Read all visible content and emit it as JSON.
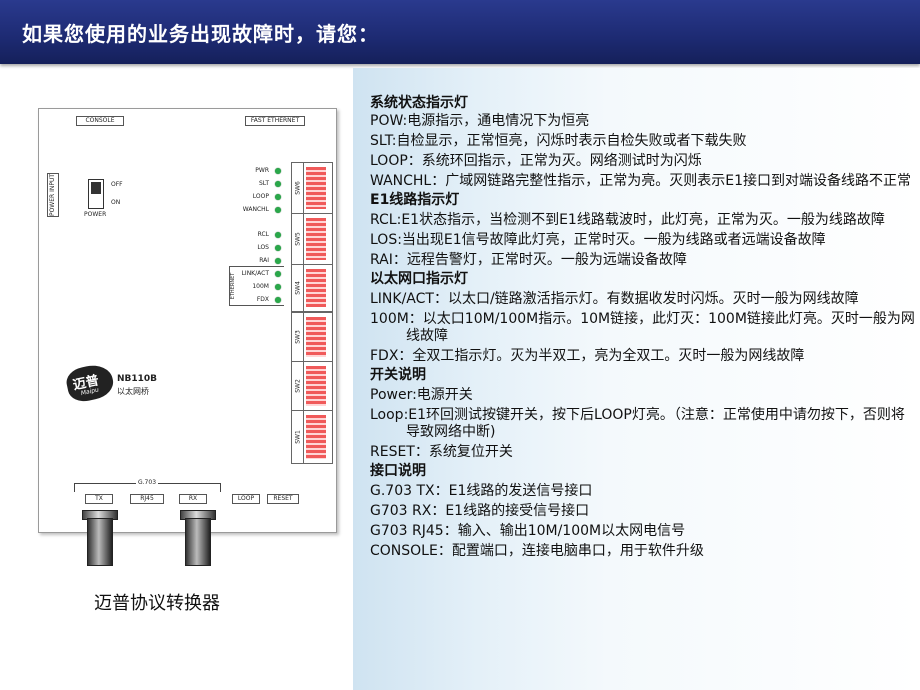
{
  "header": {
    "title": "如果您使用的业务出现故障时，请您："
  },
  "device": {
    "console_label": "CONSOLE",
    "fast_ethernet_label": "FAST ETHERNET",
    "power_input_label": "POWER INPUT",
    "switch_off": "OFF",
    "switch_on": "ON",
    "power_label": "POWER",
    "leds": [
      "PWR",
      "SLT",
      "LOOP",
      "WANCHL",
      "RCL",
      "LOS",
      "RAI",
      "LINK/ACT",
      "100M",
      "FDX"
    ],
    "ethernet_label": "ETHERNET",
    "switches": [
      "SW6",
      "SW5",
      "SW4",
      "SW3",
      "SW2",
      "SW1"
    ],
    "logo_text": "迈普",
    "logo_sub": "Maipu",
    "model": "NB110B",
    "model_sub": "以太网桥",
    "g703_label": "G.703",
    "ports": [
      "TX",
      "RJ45",
      "RX"
    ],
    "loop_button": "LOOP",
    "reset_button": "RESET"
  },
  "caption": "迈普协议转换器",
  "content": {
    "sec1_title": "系统状态指示灯",
    "pow": "POW:电源指示，通电情况下为恒亮",
    "slt": "SLT:自检显示，正常恒亮，闪烁时表示自检失败或者下载失败",
    "loop": "LOOP：系统环回指示，正常为灭。网络测试时为闪烁",
    "wanchl": "WANCHL：广域网链路完整性指示，正常为亮。灭则表示E1接口到对端设备线路不正常",
    "sec2_title": "E1线路指示灯",
    "rcl": "RCL:E1状态指示，当检测不到E1线路载波时，此灯亮，正常为灭。一般为线路故障",
    "los": "LOS:当出现E1信号故障此灯亮，正常时灭。一般为线路或者远端设备故障",
    "rai": "RAI：远程告警灯，正常时灭。一般为远端设备故障",
    "sec3_title": "以太网口指示灯",
    "linkact": "LINK/ACT：以太口/链路激活指示灯。有数据收发时闪烁。灭时一般为网线故障",
    "m100": "100M：以太口10M/100M指示。10M链接，此灯灭：100M链接此灯亮。灭时一般为网线故障",
    "fdx": "FDX：全双工指示灯。灭为半双工，亮为全双工。灭时一般为网线故障",
    "sec4_title": "开关说明",
    "power": "Power:电源开关",
    "loop_sw": "Loop:E1环回测试按键开关，按下后LOOP灯亮。（注意：正常使用中请勿按下，否则将导致网络中断)",
    "reset": "RESET：系统复位开关",
    "sec5_title": "接口说明",
    "g703tx": "G.703 TX：E1线路的发送信号接口",
    "g703rx": "G703 RX：E1线路的接受信号接口",
    "g703rj45": "G703 RJ45：输入、输出10M/100M以太网电信号",
    "console": "CONSOLE：配置端口，连接电脑串口，用于软件升级"
  }
}
